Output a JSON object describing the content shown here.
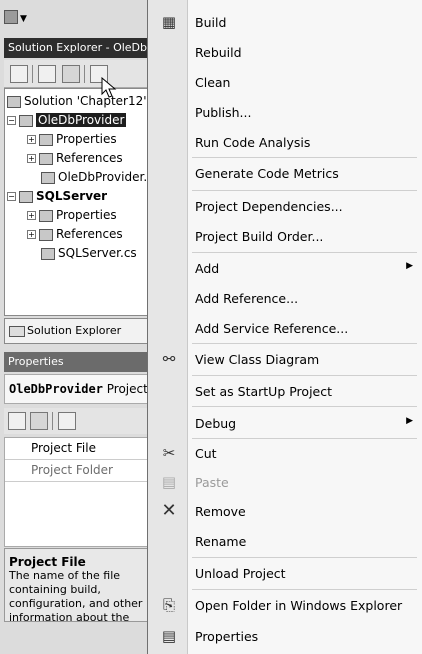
{
  "solution_explorer": {
    "title": "Solution Explorer - OleDbProvider",
    "tree": [
      {
        "label": "Solution 'Chapter12'"
      },
      {
        "label": "OleDbProvider"
      },
      {
        "label": "Properties"
      },
      {
        "label": "References"
      },
      {
        "label": "OleDbProvider.cs"
      },
      {
        "label": "SQLServer"
      },
      {
        "label": "Properties"
      },
      {
        "label": "References"
      },
      {
        "label": "SQLServer.cs"
      }
    ],
    "tab_label": "Solution Explorer"
  },
  "properties": {
    "title": "Properties",
    "object_name": "OleDbProvider",
    "object_type": "Project Properties",
    "rows": [
      "Project File",
      "Project Folder"
    ],
    "desc_title": "Project File",
    "desc_text": "The name of the file containing build, configuration, and other information about the project."
  },
  "menu": {
    "build": "Build",
    "rebuild": "Rebuild",
    "clean": "Clean",
    "publish": "Publish...",
    "run_code_analysis": "Run Code Analysis",
    "generate_metrics": "Generate Code Metrics",
    "project_dependencies": "Project Dependencies...",
    "project_build_order": "Project Build Order...",
    "add": "Add",
    "add_reference": "Add Reference...",
    "add_service_reference": "Add Service Reference...",
    "view_class_diagram": "View Class Diagram",
    "set_startup": "Set as StartUp Project",
    "debug": "Debug",
    "cut": "Cut",
    "paste": "Paste",
    "remove": "Remove",
    "rename": "Rename",
    "unload": "Unload Project",
    "open_folder": "Open Folder in Windows Explorer",
    "properties": "Properties"
  }
}
